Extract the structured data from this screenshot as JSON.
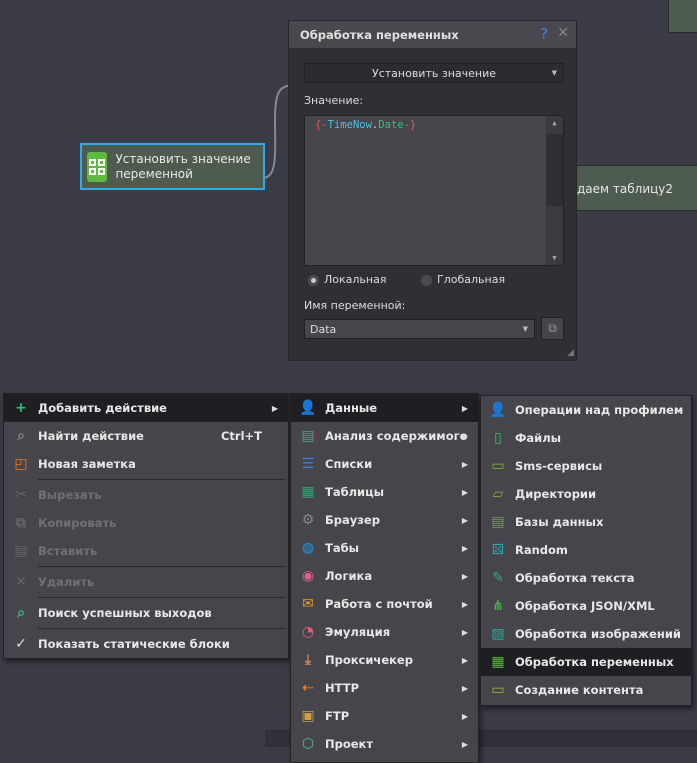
{
  "canvas": {
    "node_main": {
      "label": "Установить значение переменной",
      "icon": "variables-grid-icon"
    },
    "node_right": {
      "label": "даем таблицу2"
    }
  },
  "dialog": {
    "title": "Обработка переменных",
    "help": "?",
    "close": "✕",
    "action_select": "Установить значение",
    "value_label": "Значение:",
    "value": {
      "open": "{-",
      "name": "TimeNow",
      "dot": ".",
      "prop": "Date",
      "close": "-}"
    },
    "scope_local": "Локальная",
    "scope_global": "Глобальная",
    "scope_selected": "local",
    "varname_label": "Имя переменной:",
    "varname": "Data"
  },
  "menu1": {
    "items": [
      {
        "label": "Добавить действие",
        "icon": "plus-icon",
        "submenu": true
      },
      {
        "label": "Найти действие",
        "icon": "search-icon",
        "shortcut": "Ctrl+T"
      },
      {
        "label": "Новая заметка",
        "icon": "note-icon"
      },
      {
        "label": "Вырезать",
        "icon": "scissors-icon",
        "disabled": true
      },
      {
        "label": "Копировать",
        "icon": "copy-icon",
        "disabled": true
      },
      {
        "label": "Вставить",
        "icon": "paste-icon",
        "disabled": true
      },
      {
        "label": "Удалить",
        "icon": "delete-icon",
        "disabled": true
      },
      {
        "label": "Поиск успешных выходов",
        "icon": "search-check-icon"
      },
      {
        "label": "Показать статические блоки",
        "icon": "check-icon"
      }
    ]
  },
  "menu2": {
    "items": [
      {
        "label": "Данные",
        "icon": "user-icon"
      },
      {
        "label": "Анализ содержимого",
        "icon": "document-icon"
      },
      {
        "label": "Списки",
        "icon": "list-icon"
      },
      {
        "label": "Таблицы",
        "icon": "table-icon"
      },
      {
        "label": "Браузер",
        "icon": "gear-icon"
      },
      {
        "label": "Табы",
        "icon": "globe-icon"
      },
      {
        "label": "Логика",
        "icon": "toggle-icon"
      },
      {
        "label": "Работа с почтой",
        "icon": "mail-icon"
      },
      {
        "label": "Эмуляция",
        "icon": "mouse-icon"
      },
      {
        "label": "Проксичекер",
        "icon": "download-icon"
      },
      {
        "label": "HTTP",
        "icon": "http-get-icon"
      },
      {
        "label": "FTP",
        "icon": "ftp-icon"
      },
      {
        "label": "Проект",
        "icon": "cube-icon"
      }
    ]
  },
  "menu3": {
    "items": [
      {
        "label": "Операции над профилем",
        "icon": "user-icon"
      },
      {
        "label": "Файлы",
        "icon": "file-icon"
      },
      {
        "label": "Sms-сервисы",
        "icon": "chat-icon"
      },
      {
        "label": "Директории",
        "icon": "folder-icon"
      },
      {
        "label": "Базы данных",
        "icon": "database-icon"
      },
      {
        "label": "Random",
        "icon": "dice-icon"
      },
      {
        "label": "Обработка текста",
        "icon": "pencil-icon"
      },
      {
        "label": "Обработка JSON/XML",
        "icon": "tree-icon"
      },
      {
        "label": "Обработка изображений",
        "icon": "image-icon"
      },
      {
        "label": "Обработка переменных",
        "icon": "variables-grid-icon"
      },
      {
        "label": "Создание контента",
        "icon": "monitor-icon"
      }
    ]
  }
}
